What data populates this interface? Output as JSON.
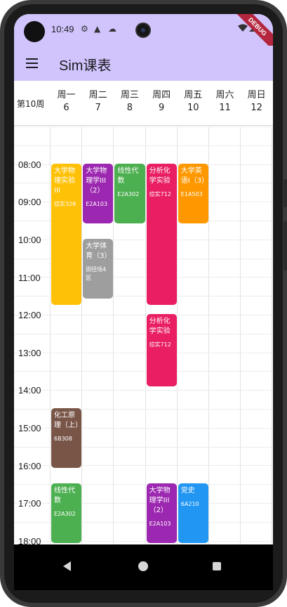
{
  "status": {
    "time": "10:49",
    "debug_label": "DEBUG",
    "icons": [
      "settings-icon",
      "warning-icon",
      "cloud-icon",
      "wifi-icon",
      "signal-icon"
    ]
  },
  "app": {
    "title": "Sim课表"
  },
  "header": {
    "week": "第10周",
    "days": [
      {
        "name": "周一",
        "date": "6"
      },
      {
        "name": "周二",
        "date": "7"
      },
      {
        "name": "周三",
        "date": "8"
      },
      {
        "name": "周四",
        "date": "9"
      },
      {
        "name": "周五",
        "date": "10"
      },
      {
        "name": "周六",
        "date": "11"
      },
      {
        "name": "周日",
        "date": "12"
      }
    ]
  },
  "hours": [
    "08:00",
    "09:00",
    "10:00",
    "11:00",
    "12:00",
    "13:00",
    "14:00",
    "15:00",
    "16:00",
    "17:00",
    "18:00"
  ],
  "courses": [
    {
      "day": 0,
      "start": "08:00",
      "end": "11:45",
      "name": "大学物理实验III",
      "room": "综实328",
      "color": "#ffc107"
    },
    {
      "day": 1,
      "start": "08:00",
      "end": "09:35",
      "name": "大学物理学III（2）",
      "room": "E2A103",
      "color": "#9c27b0"
    },
    {
      "day": 1,
      "start": "10:00",
      "end": "11:35",
      "name": "大学体育（3）",
      "room": "田径场4区",
      "color": "#9e9e9e"
    },
    {
      "day": 2,
      "start": "08:00",
      "end": "09:35",
      "name": "线性代数",
      "room": "E2A302",
      "color": "#4caf50"
    },
    {
      "day": 3,
      "start": "08:00",
      "end": "11:45",
      "name": "分析化学实验",
      "room": "综实712",
      "color": "#e91e63"
    },
    {
      "day": 3,
      "start": "12:00",
      "end": "13:55",
      "name": "分析化学实验",
      "room": "综实712",
      "color": "#e91e63"
    },
    {
      "day": 4,
      "start": "08:00",
      "end": "09:35",
      "name": "大学英语I（3）",
      "room": "E1A503",
      "color": "#ff9800"
    },
    {
      "day": 0,
      "start": "14:30",
      "end": "16:05",
      "name": "化工原理（上）",
      "room": "6B308",
      "color": "#795548"
    },
    {
      "day": 0,
      "start": "16:30",
      "end": "18:05",
      "name": "线性代数",
      "room": "E2A302",
      "color": "#4caf50"
    },
    {
      "day": 3,
      "start": "16:30",
      "end": "18:05",
      "name": "大学物理学III（2）",
      "room": "E2A103",
      "color": "#9c27b0"
    },
    {
      "day": 4,
      "start": "16:30",
      "end": "18:05",
      "name": "党史",
      "room": "6A210",
      "color": "#2196f3"
    }
  ]
}
